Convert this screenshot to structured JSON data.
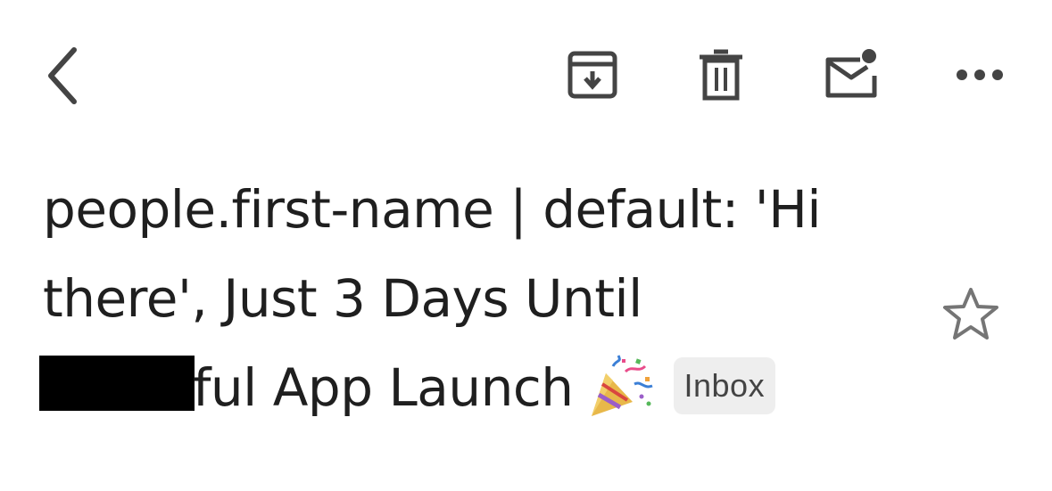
{
  "toolbar": {
    "back": "back-icon",
    "archive": "archive-icon",
    "delete": "trash-icon",
    "mark_unread": "mark-unread-icon",
    "more": "more-icon"
  },
  "message": {
    "subject_line1": "people.first-name | default: 'Hi",
    "subject_line2": "there', Just 3 Days Until",
    "subject_line3": "ful App Launch",
    "emoji": "party-popper",
    "label": "Inbox"
  },
  "star": "star-outline-icon",
  "colors": {
    "icon": "#444444",
    "text": "#1f1f1f",
    "badge_bg": "#eeeeee",
    "star": "#757575"
  }
}
